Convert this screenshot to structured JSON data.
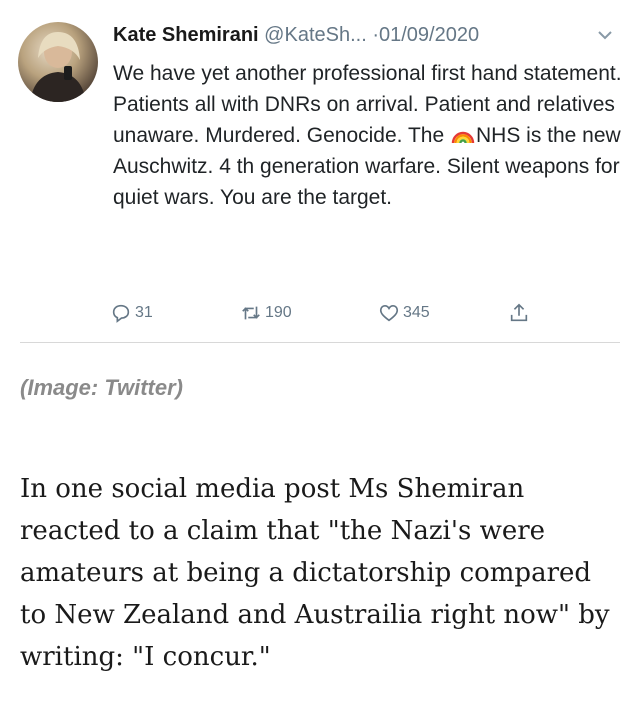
{
  "tweet": {
    "author_name": "Kate Shemirani",
    "handle": "@KateSh...",
    "separator": "·",
    "date": "01/09/2020",
    "text_part1": "We have yet another professional first hand statement. Patients all with DNRs on arrival. Patient and relatives unaware. Murdered. Genocide. The ",
    "text_part2": "NHS is the new Auschwitz. 4 th generation warfare. Silent weapons for quiet wars. You are the target.",
    "replies": "31",
    "retweets": "190",
    "likes": "345",
    "icons": [
      "reply-icon",
      "retweet-icon",
      "like-icon",
      "share-icon",
      "rainbow-emoji",
      "chevron-down-icon"
    ]
  },
  "caption": "(Image: Twitter)",
  "article": {
    "paragraph": "In one social media post Ms Shemiran reacted to a claim that \"the Nazi's were amateurs at being a dictatorship compared to New Zealand and Austrailia right now\" by writing: \"I concur.\""
  },
  "colors": {
    "muted": "#657786",
    "caption": "#8a8a8a"
  }
}
